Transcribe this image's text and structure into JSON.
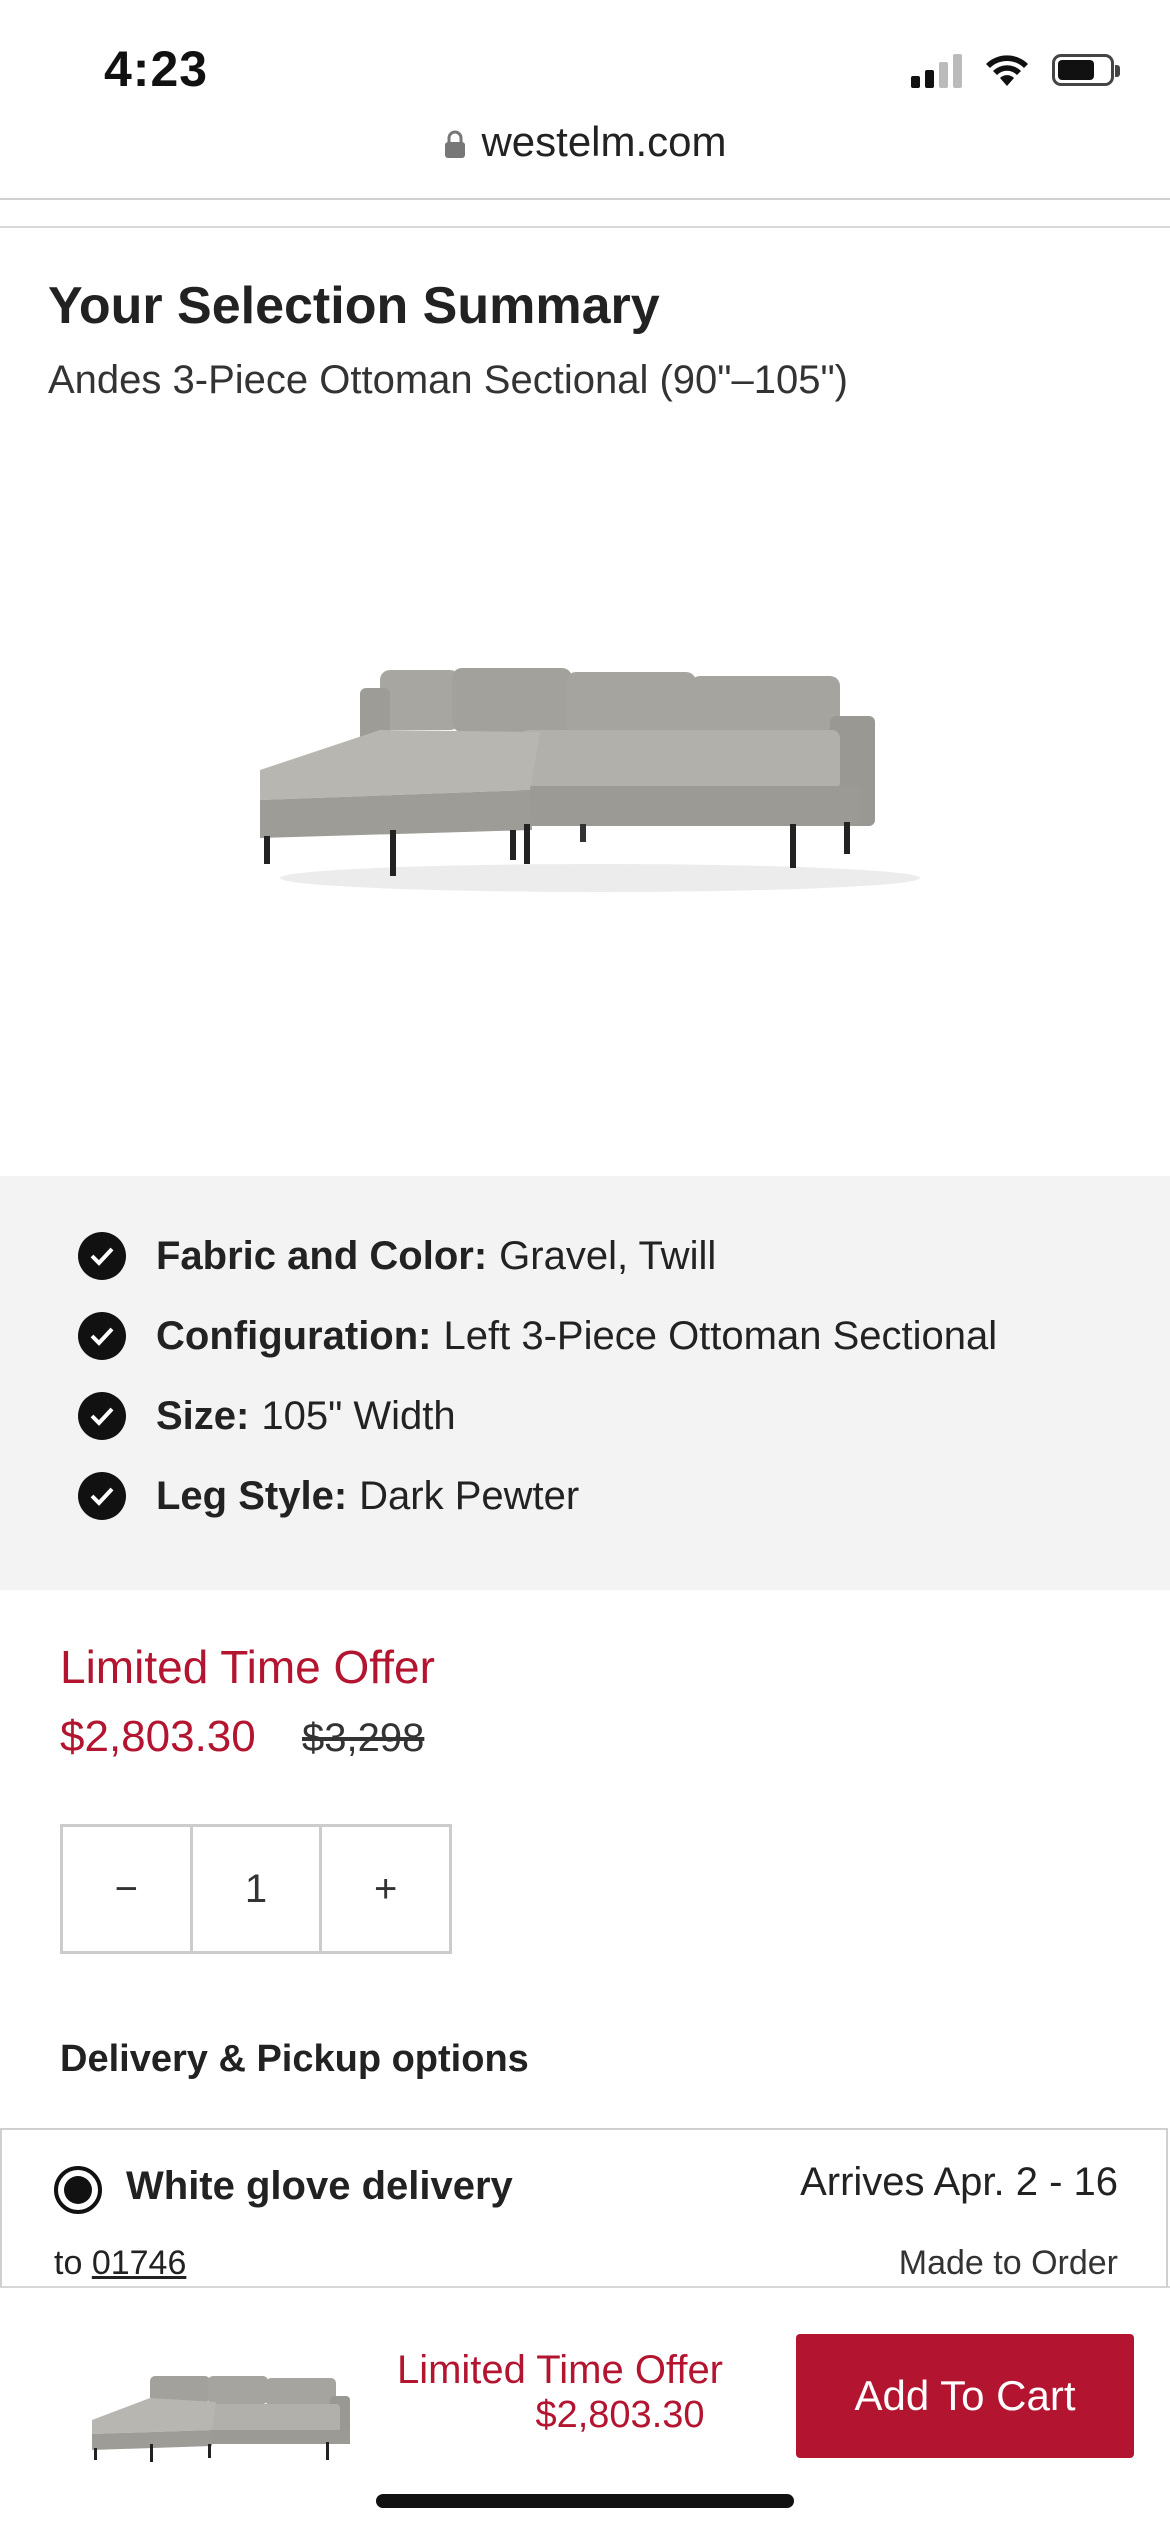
{
  "status": {
    "time": "4:23"
  },
  "browser": {
    "url": "westelm.com"
  },
  "summary": {
    "title": "Your Selection Summary",
    "product": "Andes 3-Piece Ottoman Sectional (90\"–105\")"
  },
  "selections": [
    {
      "label": "Fabric and Color:",
      "value": "Gravel, Twill"
    },
    {
      "label": "Configuration:",
      "value": "Left 3-Piece Ottoman Sectional"
    },
    {
      "label": "Size:",
      "value": "105\" Width"
    },
    {
      "label": "Leg Style:",
      "value": "Dark Pewter"
    }
  ],
  "pricing": {
    "offer_label": "Limited Time Offer",
    "price": "$2,803.30",
    "original_price": "$3,298"
  },
  "quantity": {
    "decrement": "−",
    "value": "1",
    "increment": "+"
  },
  "delivery": {
    "heading": "Delivery & Pickup options",
    "option": {
      "name": "White glove delivery",
      "arrives": "Arrives Apr. 2 - 16",
      "to_label": "to",
      "zip": "01746",
      "note": "Made to Order"
    }
  },
  "footer": {
    "offer_label": "Limited Time Offer",
    "price": "$2,803.30",
    "cart_button": "Add To Cart"
  },
  "colors": {
    "accent": "#b3142f",
    "panel": "#f3f3f3"
  }
}
